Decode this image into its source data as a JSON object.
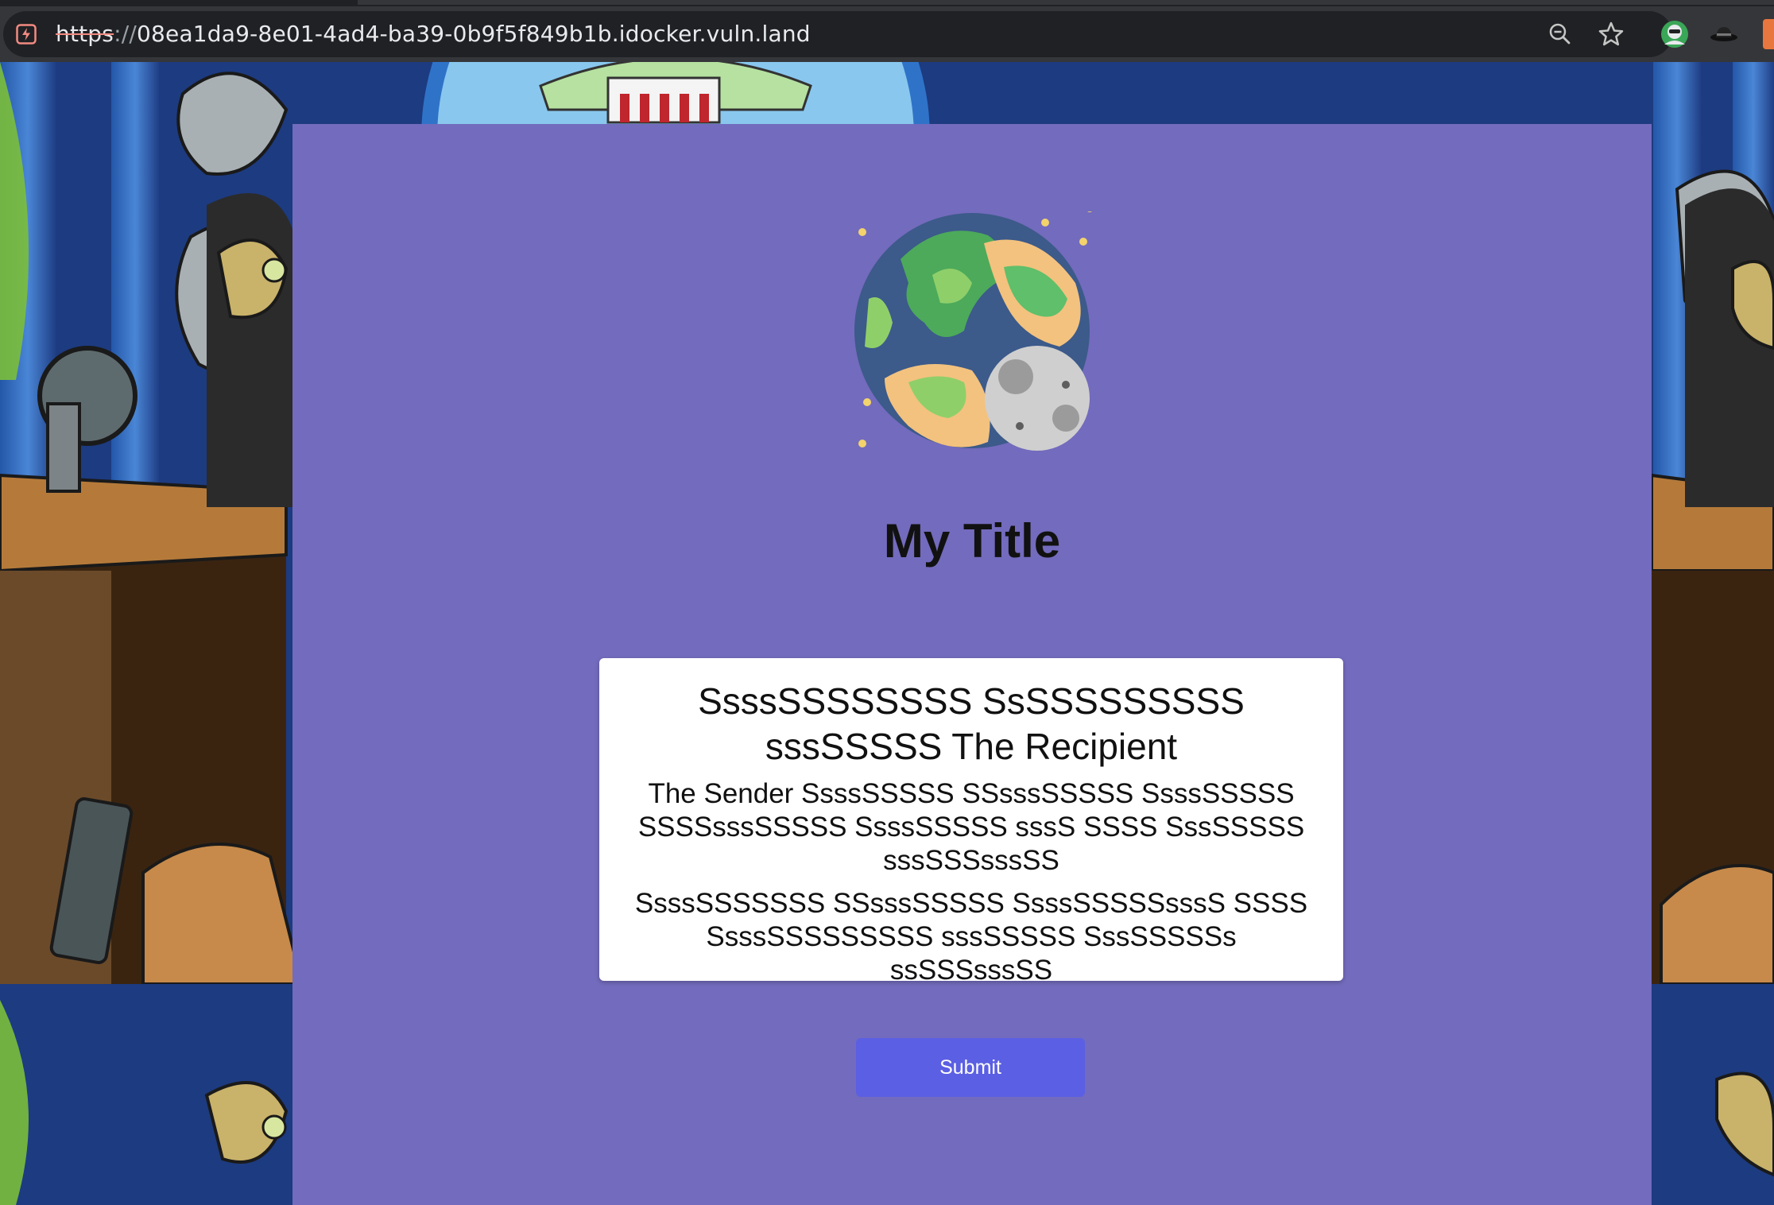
{
  "browser": {
    "url_scheme": "https",
    "url_separator": "://",
    "url_host": "08ea1da9-8e01-4ad4-ba39-0b9f5f849b1b.idocker.vuln.land",
    "icons": {
      "security": "not-secure-icon",
      "zoom": "zoom-out-icon",
      "bookmark": "star-icon",
      "extension_1": "extension-avatar-icon",
      "extension_2": "extension-hat-icon"
    }
  },
  "page": {
    "logo": "globe-moon-icon",
    "title": "My Title",
    "message": {
      "heading": "SsssSSSSSSSS SsSSSSSSSSS sssSSSSS The Recipient",
      "body_1": "The Sender SsssSSSSS SSsssSSSSS SsssSSSSS SSSSsssSSSSS SsssSSSSS sssS SSSS SssSSSSS sssSSSsssSS",
      "body_2": "SsssSSSSSSS SSsssSSSSS SsssSSSSSsssS SSSS SsssSSSSSSSSS sssSSSSS SssSSSSSs ssSSSsssSS"
    },
    "submit_label": "Submit"
  },
  "colors": {
    "panel": "#736bbd",
    "card": "#ffffff",
    "button": "#5b5fe3",
    "button_text": "#ffffff",
    "title": "#111111"
  }
}
